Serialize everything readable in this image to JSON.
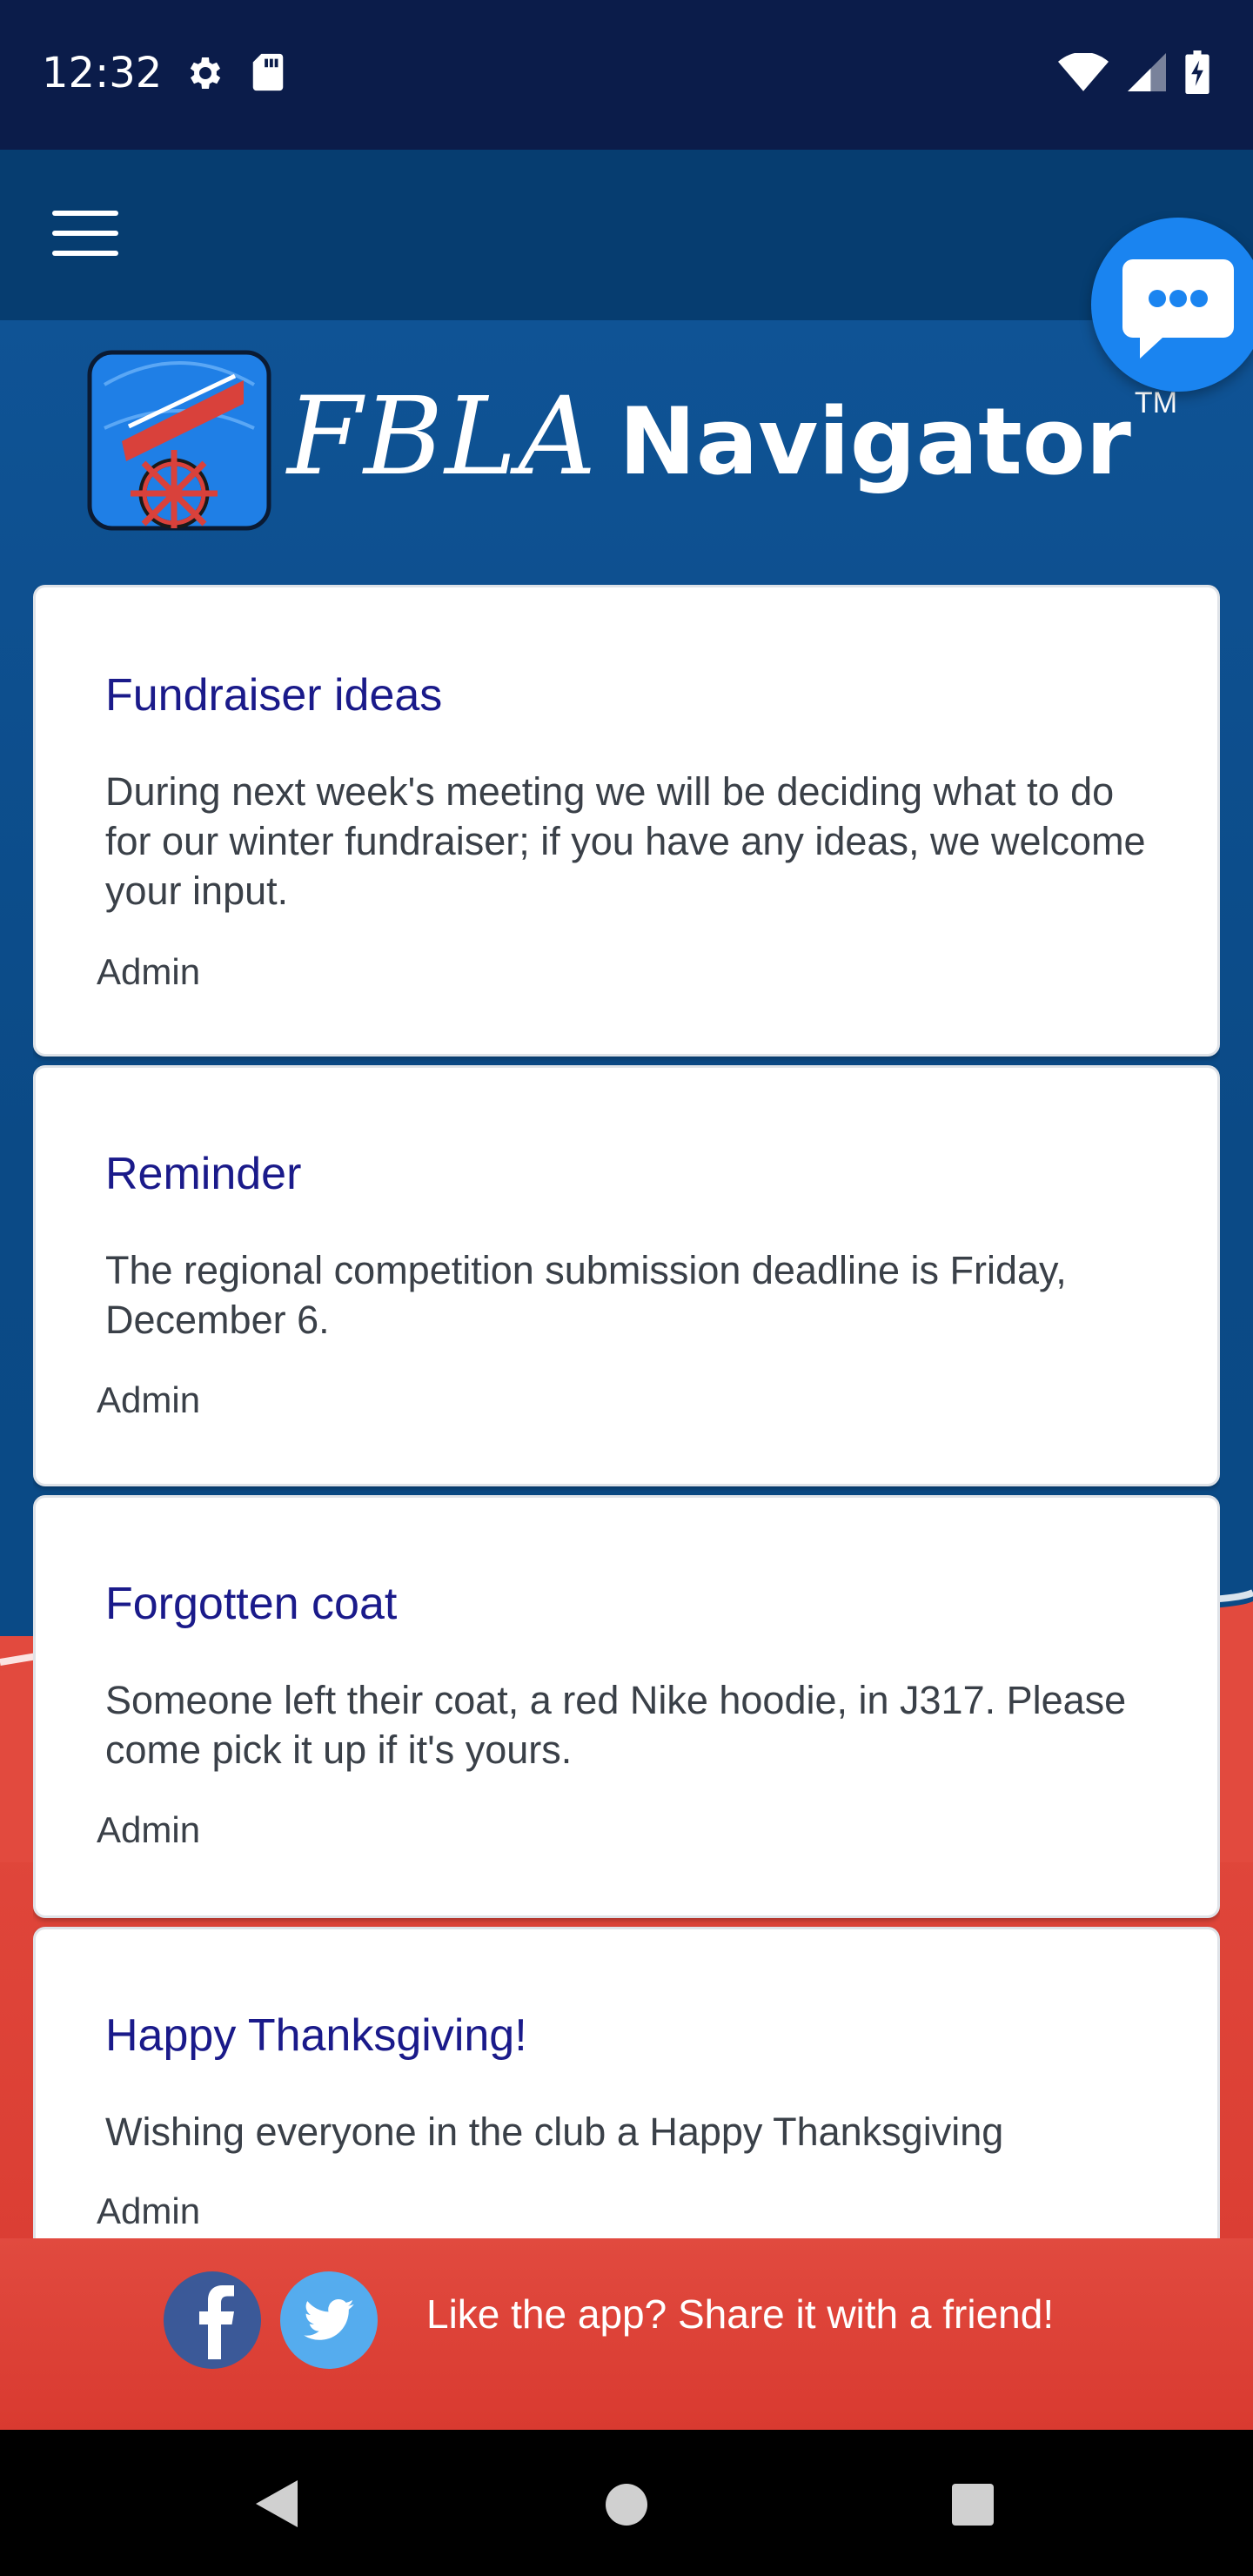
{
  "status_bar": {
    "time": "12:32",
    "left_icons": [
      "gear-icon",
      "sd-card-icon"
    ],
    "right_icons": [
      "wifi-icon",
      "signal-icon",
      "battery-charging-icon"
    ]
  },
  "app_bar": {
    "menu_icon": "hamburger-menu-icon"
  },
  "chat_button": {
    "icon": "chat-bubble-icon"
  },
  "logo": {
    "brand": "FBLA",
    "product": "Navigator",
    "trademark": "TM"
  },
  "posts": [
    {
      "title": "Fundraiser ideas",
      "body": "During next week's meeting we will be deciding what to do for our winter fundraiser; if you have any ideas, we welcome your input.",
      "author": "Admin"
    },
    {
      "title": "Reminder",
      "body": "The regional competition submission deadline is Friday, December 6.",
      "author": "Admin"
    },
    {
      "title": "Forgotten coat",
      "body": "Someone left their coat, a red Nike hoodie, in J317. Please come pick it up if it's yours.",
      "author": "Admin"
    },
    {
      "title": "Happy Thanksgiving!",
      "body": "Wishing everyone in the club a Happy Thanksgiving",
      "author": "Admin"
    }
  ],
  "share_bar": {
    "text": "Like the app? Share it with a friend!",
    "icons": [
      "facebook-icon",
      "twitter-icon"
    ]
  },
  "nav_bar": {
    "icons": [
      "back-icon",
      "home-icon",
      "recents-icon"
    ]
  },
  "colors": {
    "status_bar": "#0b1c4a",
    "app_bar": "#063d70",
    "background_blue": "#0b4a86",
    "background_red": "#e24a3e",
    "chat_fab": "#1a84f0",
    "post_title": "#1a1a8a",
    "post_body": "#3a4048",
    "facebook": "#3b5998",
    "twitter": "#55acee"
  }
}
